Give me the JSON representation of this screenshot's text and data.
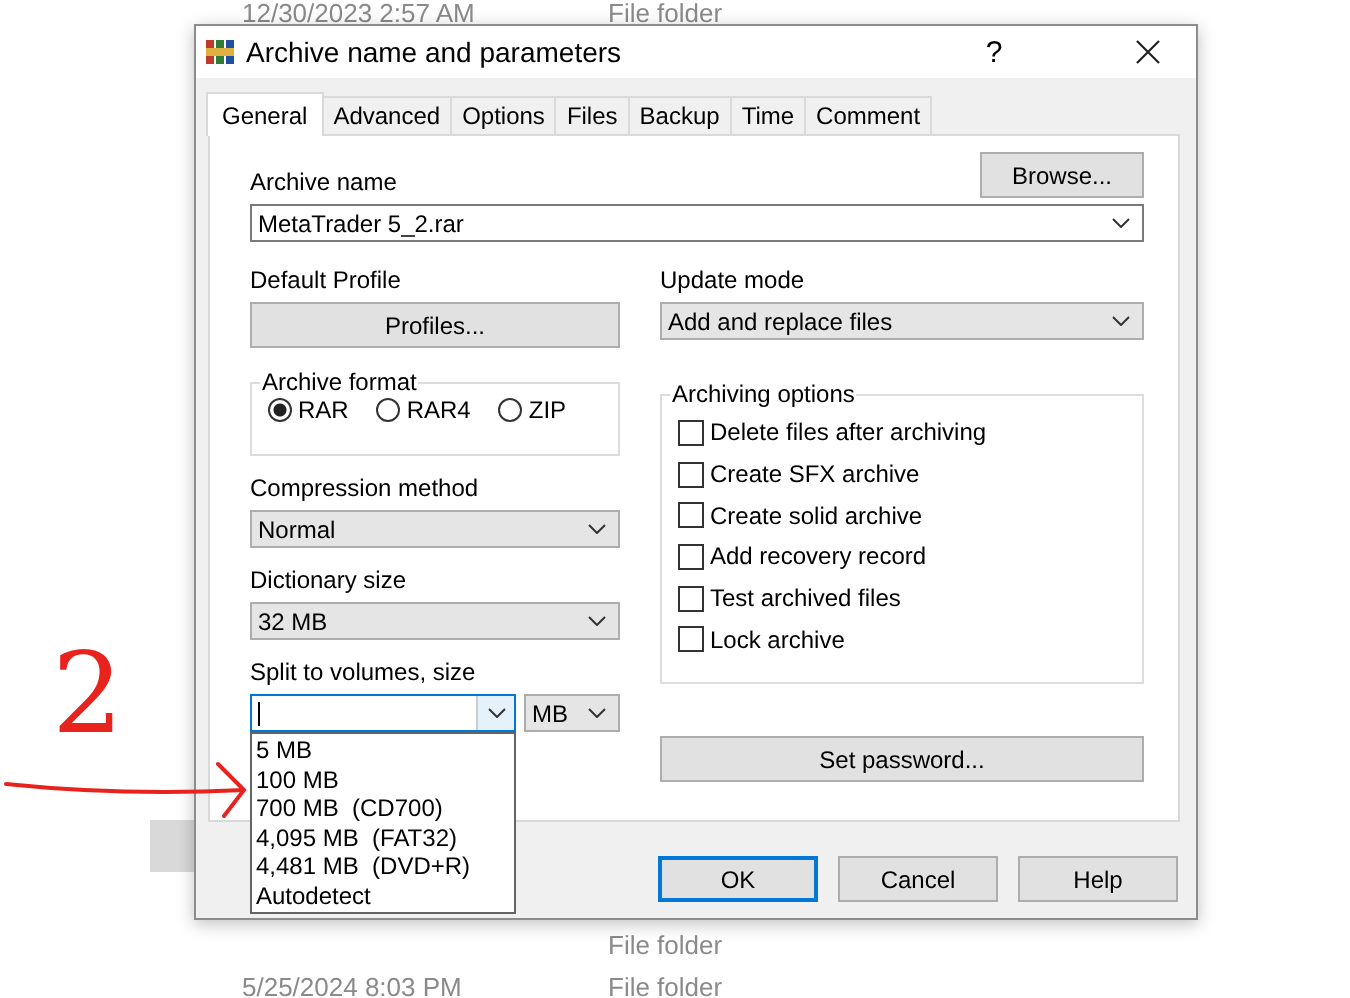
{
  "background_rows": [
    {
      "date": "12/30/2023 2:57 AM",
      "type": "File folder"
    },
    {
      "type": "File folder"
    },
    {
      "date": "5/25/2024 8:03 PM",
      "type": "File folder"
    }
  ],
  "annotation": {
    "label": "2"
  },
  "window": {
    "title": "Archive name and parameters",
    "help": "?"
  },
  "tabs": [
    {
      "label": "General",
      "selected": true
    },
    {
      "label": "Advanced",
      "selected": false
    },
    {
      "label": "Options",
      "selected": false
    },
    {
      "label": "Files",
      "selected": false
    },
    {
      "label": "Backup",
      "selected": false
    },
    {
      "label": "Time",
      "selected": false
    },
    {
      "label": "Comment",
      "selected": false
    }
  ],
  "archive_name": {
    "label": "Archive name",
    "value": "MetaTrader 5_2.rar",
    "browse_button": "Browse..."
  },
  "default_profile": {
    "label": "Default Profile",
    "button": "Profiles..."
  },
  "update_mode": {
    "label": "Update mode",
    "value": "Add and replace files"
  },
  "archive_format": {
    "label": "Archive format",
    "options": [
      {
        "label": "RAR",
        "selected": true
      },
      {
        "label": "RAR4",
        "selected": false
      },
      {
        "label": "ZIP",
        "selected": false
      }
    ]
  },
  "compression_method": {
    "label": "Compression method",
    "value": "Normal"
  },
  "dictionary_size": {
    "label": "Dictionary size",
    "value": "32 MB"
  },
  "split_volumes": {
    "label": "Split to volumes, size",
    "unit": "MB",
    "expanded": true,
    "list": [
      {
        "label": "5 MB"
      },
      {
        "label": "100 MB"
      },
      {
        "label": "700 MB  (CD700)"
      },
      {
        "label": "4,095 MB  (FAT32)"
      },
      {
        "label": "4,481 MB  (DVD+R)"
      },
      {
        "label": "Autodetect"
      }
    ]
  },
  "archiving_options": {
    "label": "Archiving options",
    "options": [
      {
        "label": "Delete files after archiving",
        "checked": false
      },
      {
        "label": "Create SFX archive",
        "checked": false
      },
      {
        "label": "Create solid archive",
        "checked": false
      },
      {
        "label": "Add recovery record",
        "checked": false
      },
      {
        "label": "Test archived files",
        "checked": false
      },
      {
        "label": "Lock archive",
        "checked": false
      }
    ]
  },
  "set_password_button": "Set password...",
  "buttons": [
    {
      "label": "OK",
      "default": true
    },
    {
      "label": "Cancel",
      "default": false
    },
    {
      "label": "Help",
      "default": false
    }
  ]
}
